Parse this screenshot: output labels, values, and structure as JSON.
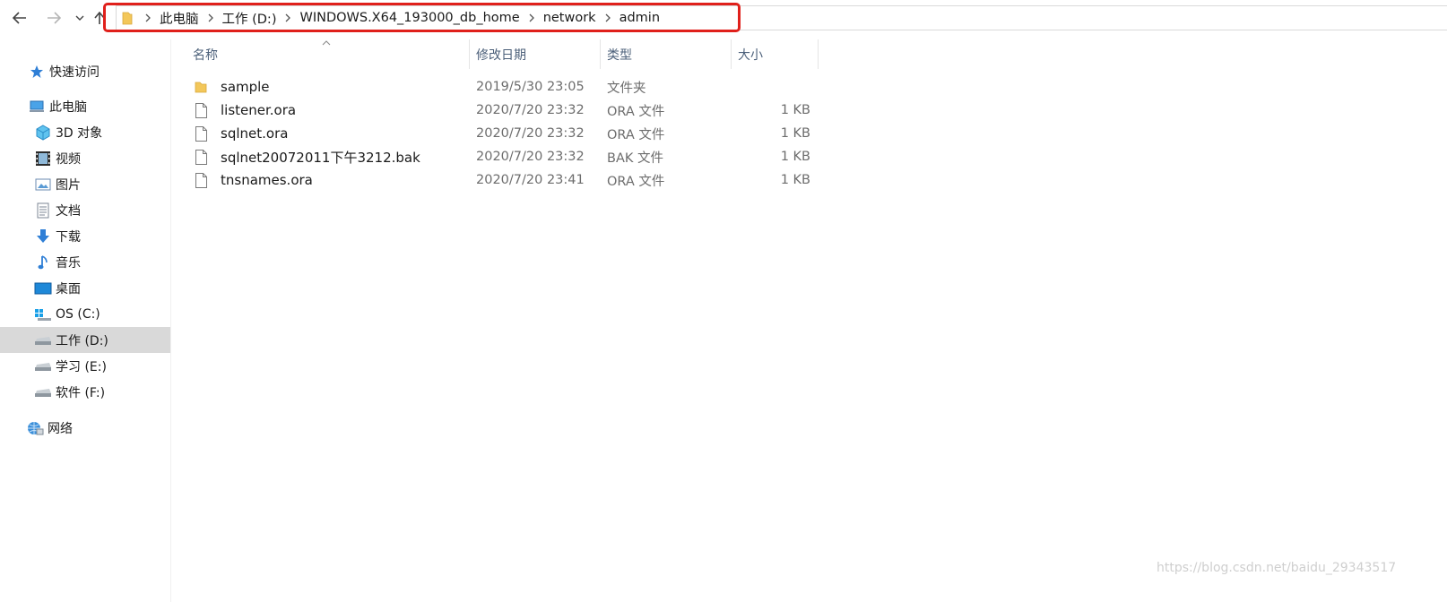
{
  "address": {
    "crumbs": [
      "此电脑",
      "工作 (D:)",
      "WINDOWS.X64_193000_db_home",
      "network",
      "admin"
    ]
  },
  "sidebar": {
    "quick_access": "快速访问",
    "this_pc": "此电脑",
    "items": [
      {
        "label": "3D 对象",
        "icon": "3d-objects-icon"
      },
      {
        "label": "视频",
        "icon": "video-icon"
      },
      {
        "label": "图片",
        "icon": "pictures-icon"
      },
      {
        "label": "文档",
        "icon": "documents-icon"
      },
      {
        "label": "下载",
        "icon": "downloads-icon"
      },
      {
        "label": "音乐",
        "icon": "music-icon"
      },
      {
        "label": "桌面",
        "icon": "desktop-icon"
      },
      {
        "label": "OS (C:)",
        "icon": "windows-drive-icon"
      },
      {
        "label": "工作 (D:)",
        "icon": "drive-icon"
      },
      {
        "label": "学习 (E:)",
        "icon": "drive-icon"
      },
      {
        "label": "软件 (F:)",
        "icon": "drive-icon"
      }
    ],
    "network": "网络",
    "selected_index": 8
  },
  "columns": {
    "name": "名称",
    "date": "修改日期",
    "type": "类型",
    "size": "大小"
  },
  "files": [
    {
      "name": "sample",
      "date": "2019/5/30 23:05",
      "type": "文件夹",
      "size": "",
      "icon": "folder-icon"
    },
    {
      "name": "listener.ora",
      "date": "2020/7/20 23:32",
      "type": "ORA 文件",
      "size": "1 KB",
      "icon": "file-icon"
    },
    {
      "name": "sqlnet.ora",
      "date": "2020/7/20 23:32",
      "type": "ORA 文件",
      "size": "1 KB",
      "icon": "file-icon"
    },
    {
      "name": "sqlnet20072011下午3212.bak",
      "date": "2020/7/20 23:32",
      "type": "BAK 文件",
      "size": "1 KB",
      "icon": "file-icon"
    },
    {
      "name": "tnsnames.ora",
      "date": "2020/7/20 23:41",
      "type": "ORA 文件",
      "size": "1 KB",
      "icon": "file-icon"
    }
  ],
  "watermark": "https://blog.csdn.net/baidu_29343517",
  "colors": {
    "highlight_border": "#e0201b",
    "selected_bg": "#d9d9d9",
    "header_text": "#4c607a"
  }
}
